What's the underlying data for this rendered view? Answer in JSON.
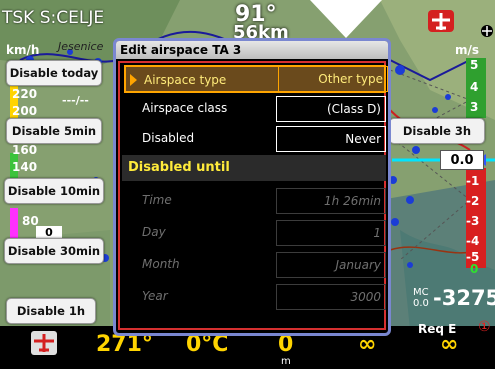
{
  "map": {
    "task_label": "TSK S:CELJE",
    "top_value_1": "91°",
    "top_value_2": "56km",
    "place_label": "Jesenice"
  },
  "left_scale": {
    "unit": "km/h",
    "ticks": [
      "220",
      "200",
      "160",
      "140",
      "80"
    ],
    "speed_box": "---/--",
    "current": "0"
  },
  "right_scale": {
    "unit": "m/s",
    "ticks": [
      "5",
      "4",
      "3",
      "-1",
      "-2",
      "-3",
      "-4",
      "-5",
      "0"
    ],
    "current_box": "0.0"
  },
  "side_buttons": {
    "disable_today": "Disable today",
    "disable_5min": "Disable 5min",
    "disable_10min": "Disable 10min",
    "disable_30min": "Disable 30min",
    "disable_1h": "Disable 1h",
    "disable_3h": "Disable 3h"
  },
  "dialog": {
    "title": "Edit airspace TA 3",
    "rows": [
      {
        "label": "Airspace type",
        "value": "Other type"
      },
      {
        "label": "Airspace class",
        "value": "(Class D)"
      },
      {
        "label": "Disabled",
        "value": "Never"
      }
    ],
    "section_title": "Disabled until",
    "disabled_rows": [
      {
        "label": "Time",
        "value": "1h 26min"
      },
      {
        "label": "Day",
        "value": "1"
      },
      {
        "label": "Month",
        "value": "January"
      },
      {
        "label": "Year",
        "value": "3000"
      }
    ]
  },
  "mc": {
    "label": "MC",
    "value": "0.0",
    "altitude": "-3275"
  },
  "bottom": {
    "heading": "271°",
    "temperature": "0°C",
    "value3": "0",
    "value3_unit": "m",
    "value4": "∞",
    "value5": "∞",
    "req_label": "Req E",
    "req_num": "①"
  },
  "colors": {
    "dialog_border": "#7a87d0",
    "body_border": "#d63030",
    "selected_bg": "#6a4a1c",
    "selected_border": "#ffa500",
    "label_yellow": "#ffeb3b",
    "bottom_value": "#ffd400"
  }
}
